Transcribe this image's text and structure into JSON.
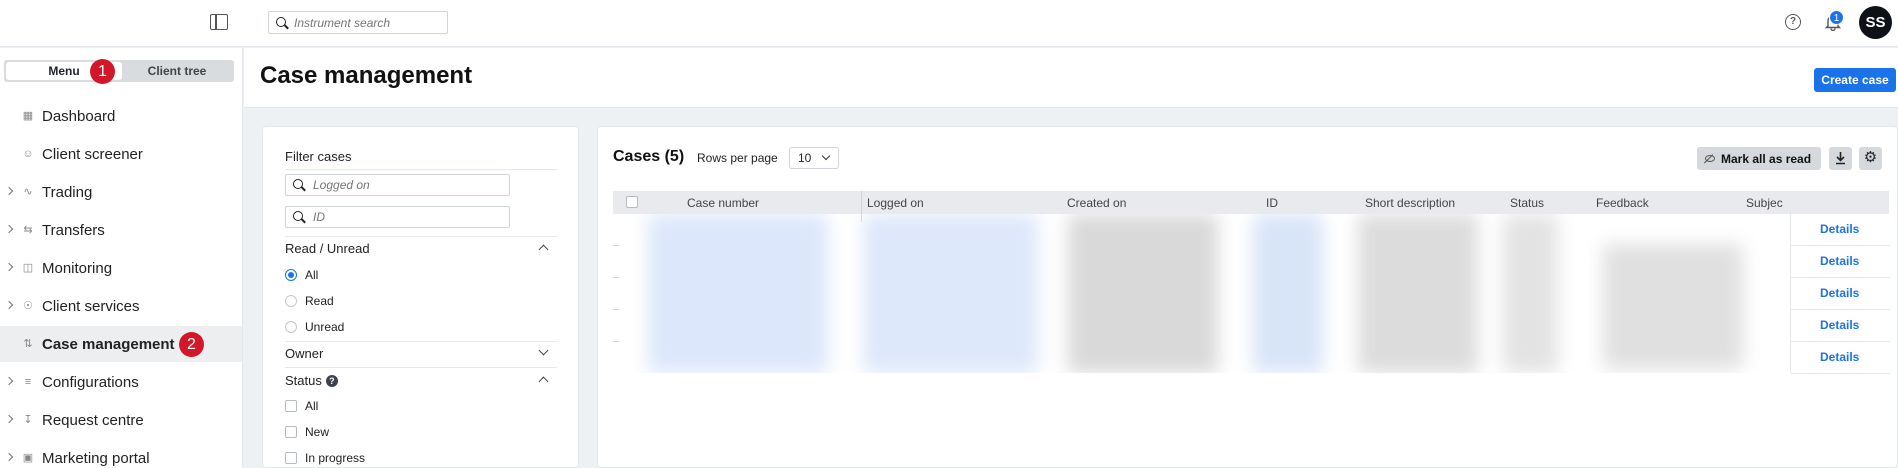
{
  "topbar": {
    "search_placeholder": "Instrument search",
    "notification_count": "1",
    "avatar_initials": "SS"
  },
  "sidebar": {
    "segment": {
      "menu": "Menu",
      "client_tree": "Client tree"
    },
    "markers": [
      "1",
      "2"
    ],
    "items": [
      {
        "label": "Dashboard",
        "icon": "dashboard-icon",
        "expandable": false
      },
      {
        "label": "Client screener",
        "icon": "user-circle-icon",
        "expandable": false
      },
      {
        "label": "Trading",
        "icon": "trading-icon",
        "expandable": true
      },
      {
        "label": "Transfers",
        "icon": "transfer-icon",
        "expandable": true
      },
      {
        "label": "Monitoring",
        "icon": "monitoring-icon",
        "expandable": true
      },
      {
        "label": "Client services",
        "icon": "client-services-icon",
        "expandable": true
      },
      {
        "label": "Case management",
        "icon": "case-icon",
        "expandable": false,
        "active": true
      },
      {
        "label": "Configurations",
        "icon": "sliders-icon",
        "expandable": true
      },
      {
        "label": "Request centre",
        "icon": "download-icon",
        "expandable": true
      },
      {
        "label": "Marketing portal",
        "icon": "portal-icon",
        "expandable": true
      }
    ]
  },
  "header": {
    "title": "Case management",
    "create_label": "Create case"
  },
  "filters": {
    "title": "Filter cases",
    "logged_on_placeholder": "Logged on",
    "id_placeholder": "ID",
    "read_unread": {
      "label": "Read / Unread",
      "options": [
        "All",
        "Read",
        "Unread"
      ],
      "selected": "All"
    },
    "owner": {
      "label": "Owner"
    },
    "status": {
      "label": "Status",
      "options": [
        "All",
        "New",
        "In progress"
      ]
    }
  },
  "cases": {
    "title": "Cases (5)",
    "rows_per_page_label": "Rows per page",
    "rows_per_page_value": "10",
    "mark_all_label": "Mark all as read",
    "columns": [
      "Case number",
      "Logged on",
      "Created on",
      "ID",
      "Short description",
      "Status",
      "Feedback",
      "Subjec"
    ],
    "row_action_label": "Details",
    "row_count": 5
  },
  "colors": {
    "accent": "#1a73e8",
    "marker": "#d3172a",
    "avatar": "#0e1116"
  }
}
